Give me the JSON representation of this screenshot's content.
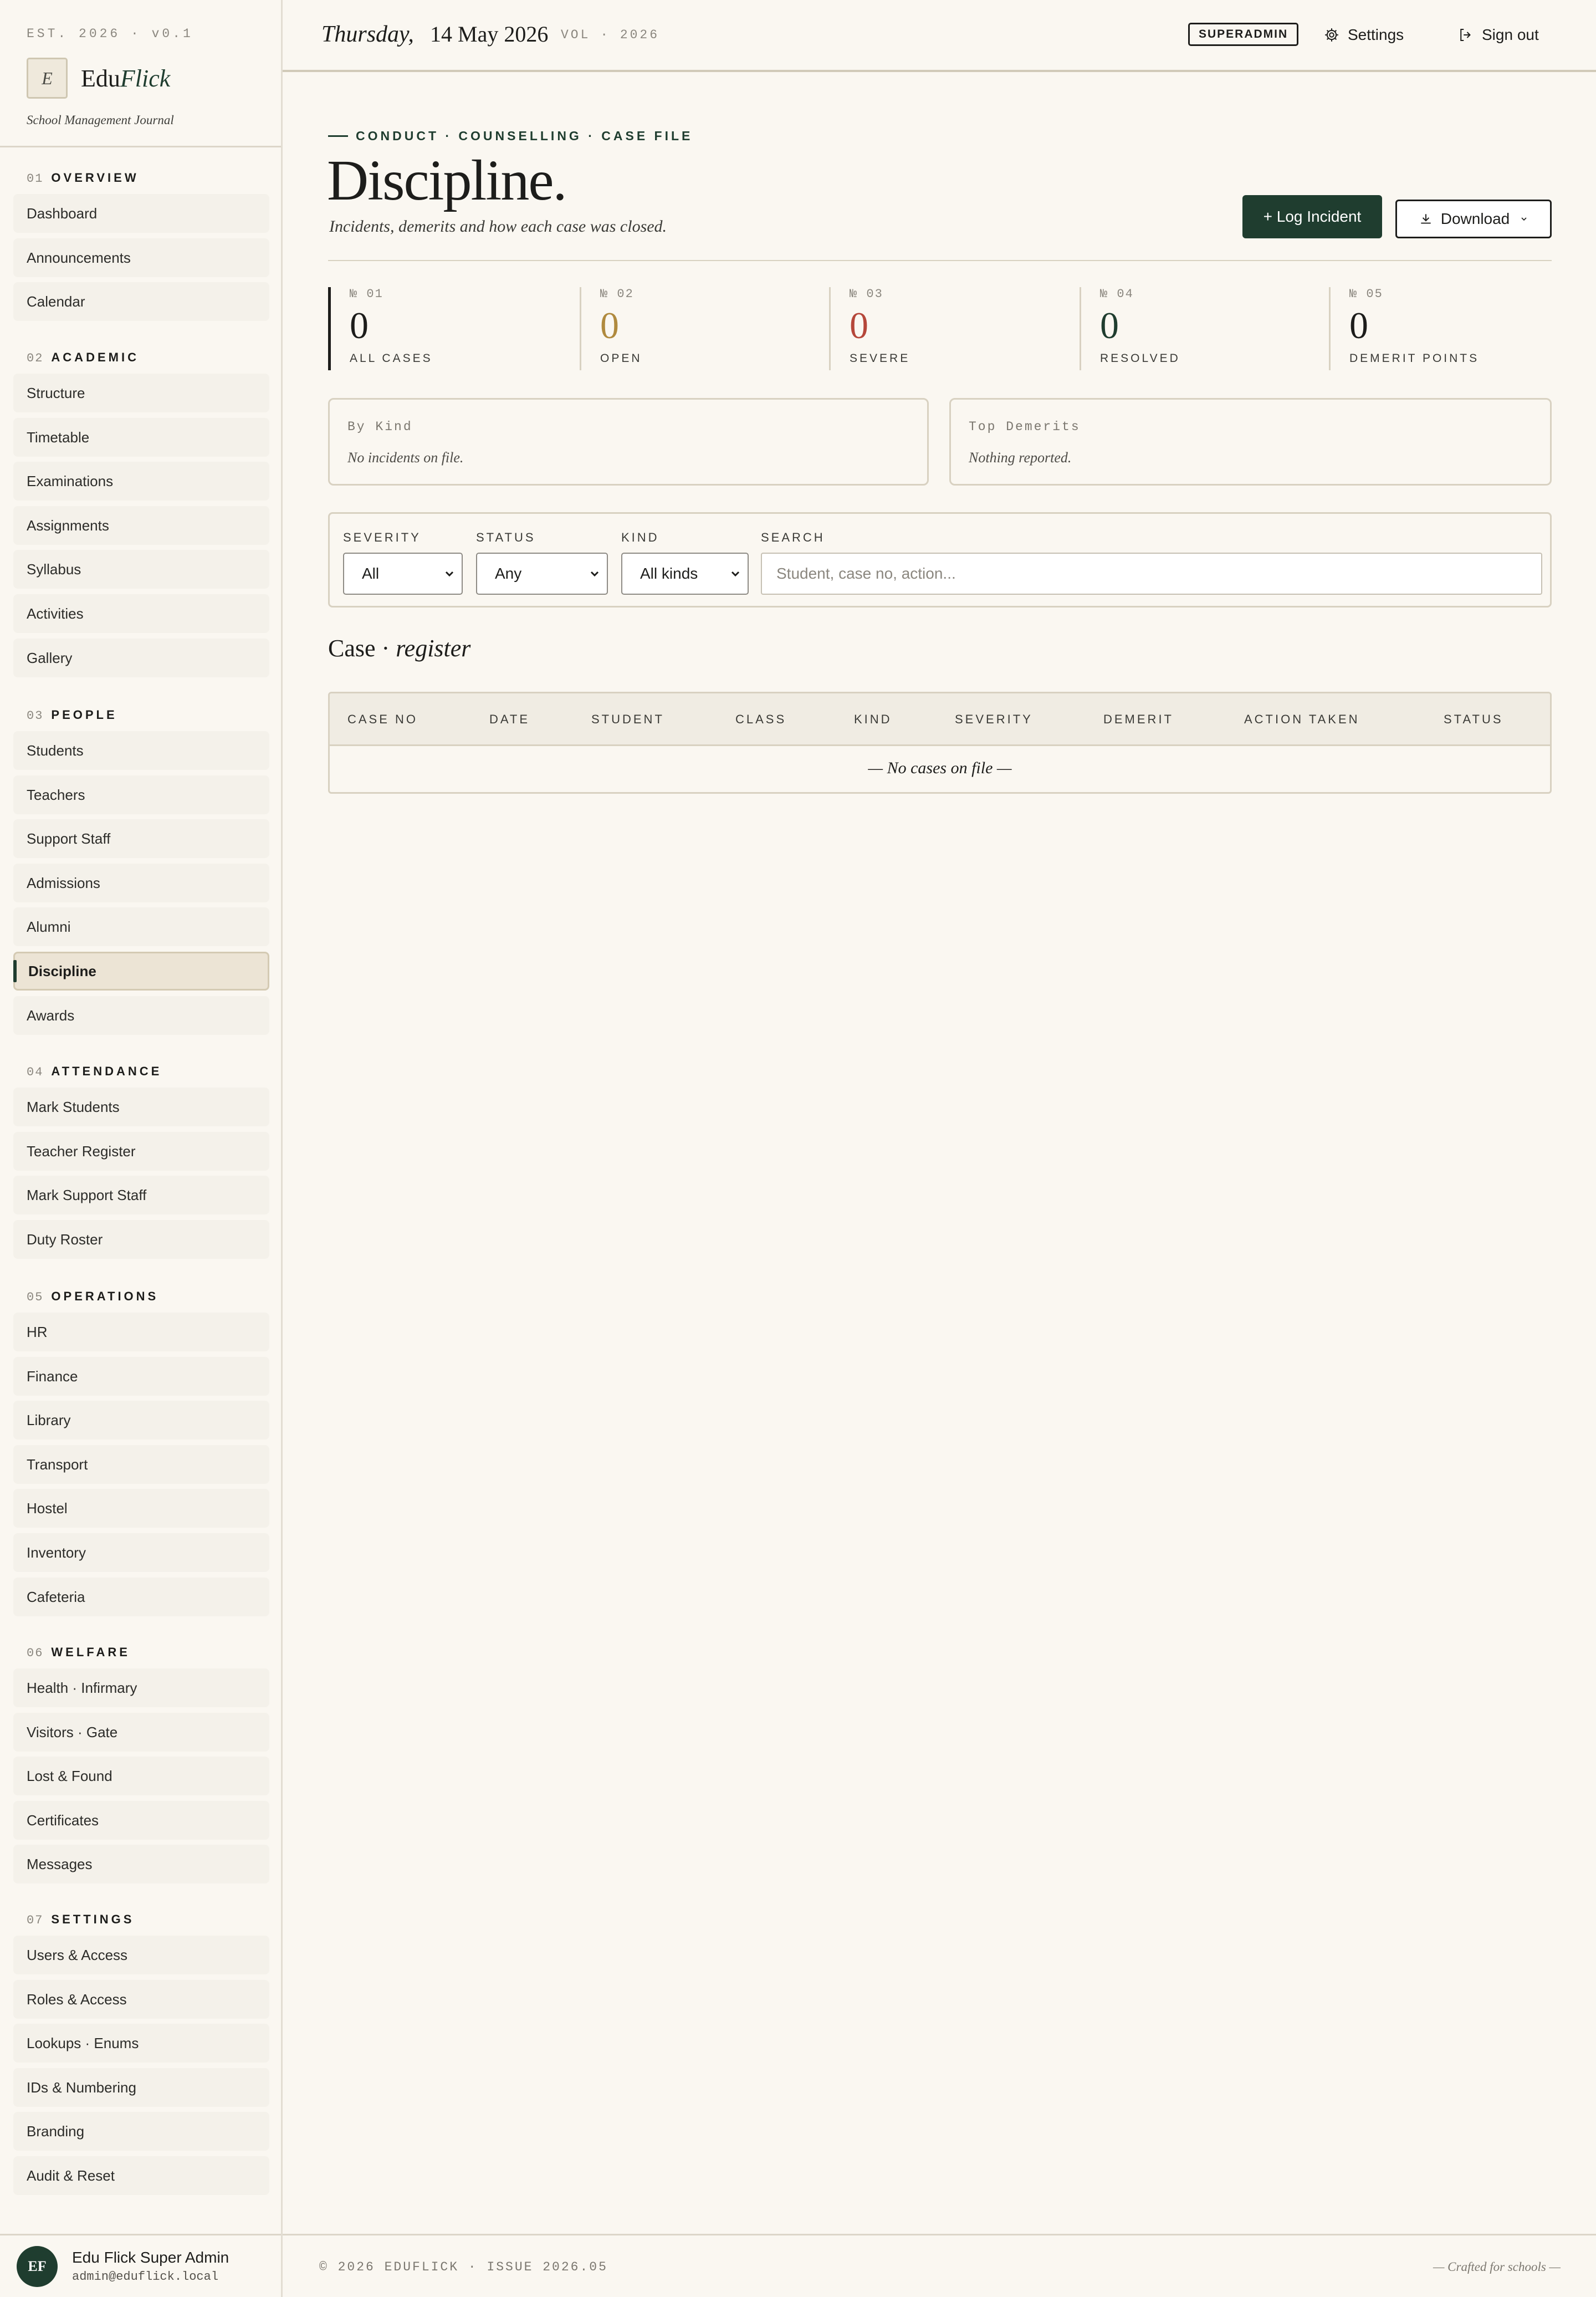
{
  "brand": {
    "est": "EST. 2026 · v0.1",
    "logo_letter": "E",
    "name_plain": "Edu",
    "name_styled": "Flick",
    "tagline": "School Management Journal"
  },
  "topbar": {
    "day": "Thursday,",
    "date": "14 May 2026",
    "volume": "VOL · 2026",
    "role": "SUPERADMIN",
    "settings_label": "Settings",
    "signout_label": "Sign out"
  },
  "sidebar": {
    "sections": [
      {
        "num": "01",
        "label": "OVERVIEW",
        "items": [
          "Dashboard",
          "Announcements",
          "Calendar"
        ]
      },
      {
        "num": "02",
        "label": "ACADEMIC",
        "items": [
          "Structure",
          "Timetable",
          "Examinations",
          "Assignments",
          "Syllabus",
          "Activities",
          "Gallery"
        ]
      },
      {
        "num": "03",
        "label": "PEOPLE",
        "items": [
          "Students",
          "Teachers",
          "Support Staff",
          "Admissions",
          "Alumni",
          "Discipline",
          "Awards"
        ]
      },
      {
        "num": "04",
        "label": "ATTENDANCE",
        "items": [
          "Mark Students",
          "Teacher Register",
          "Mark Support Staff",
          "Duty Roster"
        ]
      },
      {
        "num": "05",
        "label": "OPERATIONS",
        "items": [
          "HR",
          "Finance",
          "Library",
          "Transport",
          "Hostel",
          "Inventory",
          "Cafeteria"
        ]
      },
      {
        "num": "06",
        "label": "WELFARE",
        "items": [
          "Health · Infirmary",
          "Visitors · Gate",
          "Lost & Found",
          "Certificates",
          "Messages"
        ]
      },
      {
        "num": "07",
        "label": "SETTINGS",
        "items": [
          "Users & Access",
          "Roles & Access",
          "Lookups · Enums",
          "IDs & Numbering",
          "Branding",
          "Audit & Reset"
        ]
      }
    ],
    "active_item": "Discipline"
  },
  "user": {
    "initials": "EF",
    "name": "Edu Flick Super Admin",
    "email": "admin@eduflick.local"
  },
  "page": {
    "eyebrow": "CONDUCT · COUNSELLING · CASE FILE",
    "title": "Discipline.",
    "subtitle": "Incidents, demerits and how each case was closed.",
    "primary_button": "+ Log Incident",
    "download_button": "Download"
  },
  "stats": [
    {
      "num": "№ 01",
      "value": "0",
      "label": "ALL CASES",
      "color": "#1d1d1b"
    },
    {
      "num": "№ 02",
      "value": "0",
      "label": "OPEN",
      "color": "#b08a3e"
    },
    {
      "num": "№ 03",
      "value": "0",
      "label": "SEVERE",
      "color": "#b5473a"
    },
    {
      "num": "№ 04",
      "value": "0",
      "label": "RESOLVED",
      "color": "#1f3d2f"
    },
    {
      "num": "№ 05",
      "value": "0",
      "label": "DEMERIT POINTS",
      "color": "#1d1d1b"
    }
  ],
  "panels": {
    "by_kind": {
      "title": "By Kind",
      "empty": "No incidents on file."
    },
    "top_demerits": {
      "title": "Top Demerits",
      "empty": "Nothing reported."
    }
  },
  "filters": {
    "severity": {
      "label": "SEVERITY",
      "value": "All"
    },
    "status": {
      "label": "STATUS",
      "value": "Any"
    },
    "kind": {
      "label": "KIND",
      "value": "All kinds"
    },
    "search": {
      "label": "SEARCH",
      "placeholder": "Student, case no, action..."
    }
  },
  "register": {
    "title_plain": "Case ·",
    "title_italic": "register",
    "columns": [
      "CASE NO",
      "DATE",
      "STUDENT",
      "CLASS",
      "KIND",
      "SEVERITY",
      "DEMERIT",
      "ACTION TAKEN",
      "STATUS"
    ],
    "empty": "— No cases on file —"
  },
  "footer": {
    "left": "© 2026 EDUFLICK · ISSUE 2026.05",
    "right": "— Crafted for schools —"
  },
  "colors": {
    "accent": "#1f3d2f",
    "background": "#faf7f1",
    "active_nav": "#ece4d5",
    "open": "#b08a3e",
    "severe": "#b5473a"
  }
}
